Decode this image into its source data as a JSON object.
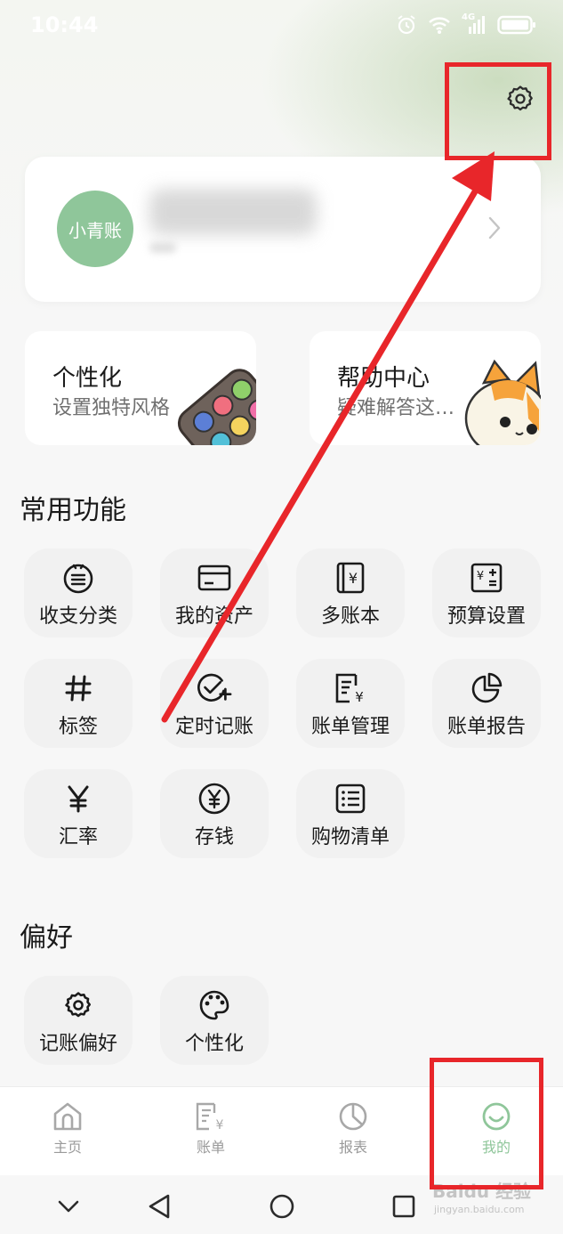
{
  "status_bar": {
    "time": "10:44",
    "network": "4G"
  },
  "profile": {
    "avatar_text": "小青账"
  },
  "feature_cards": [
    {
      "title": "个性化",
      "subtitle": "设置独特风格"
    },
    {
      "title": "帮助中心",
      "subtitle": "疑难解答这…"
    }
  ],
  "sections": {
    "common": {
      "title": "常用功能",
      "items": [
        {
          "label": "收支分类",
          "icon": "category-icon"
        },
        {
          "label": "我的资产",
          "icon": "card-icon"
        },
        {
          "label": "多账本",
          "icon": "ledger-book-icon"
        },
        {
          "label": "预算设置",
          "icon": "budget-icon"
        },
        {
          "label": "标签",
          "icon": "hashtag-icon"
        },
        {
          "label": "定时记账",
          "icon": "scheduled-check-icon"
        },
        {
          "label": "账单管理",
          "icon": "bill-manage-icon"
        },
        {
          "label": "账单报告",
          "icon": "pie-report-icon"
        },
        {
          "label": "汇率",
          "icon": "yen-icon"
        },
        {
          "label": "存钱",
          "icon": "coin-icon"
        },
        {
          "label": "购物清单",
          "icon": "list-icon"
        }
      ]
    },
    "prefs": {
      "title": "偏好",
      "items": [
        {
          "label": "记账偏好",
          "icon": "gear-icon"
        },
        {
          "label": "个性化",
          "icon": "palette-icon"
        }
      ]
    }
  },
  "bottom_nav": [
    {
      "label": "主页",
      "icon": "home-icon",
      "active": false
    },
    {
      "label": "账单",
      "icon": "bill-icon",
      "active": false
    },
    {
      "label": "报表",
      "icon": "chart-icon",
      "active": false
    },
    {
      "label": "我的",
      "icon": "smile-icon",
      "active": true
    }
  ],
  "watermark": {
    "text": "Baidu 经验",
    "url": "jingyan.baidu.com"
  },
  "colors": {
    "accent": "#8fc69a",
    "annotation": "#e8262a",
    "tile_bg": "#f1f1f1"
  }
}
